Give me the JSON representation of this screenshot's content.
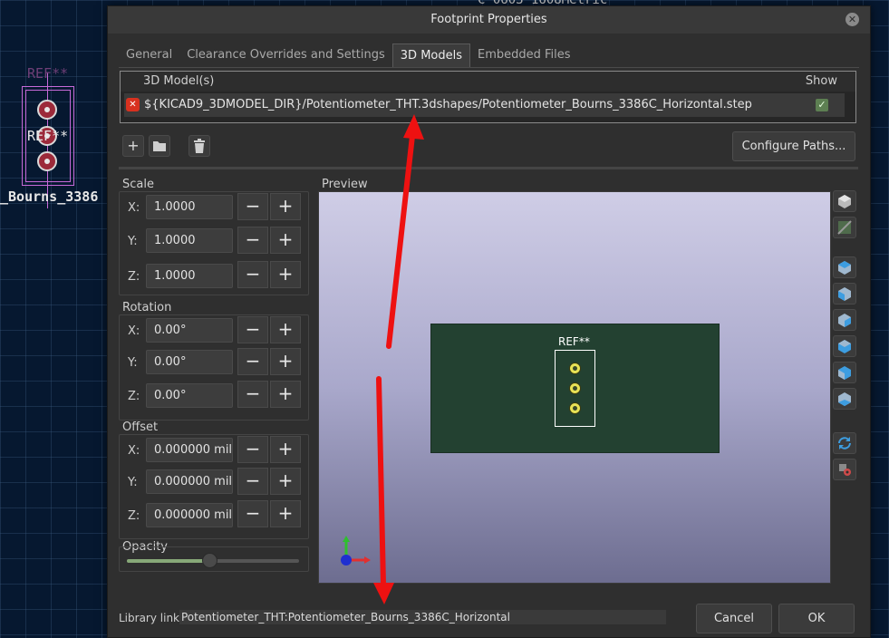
{
  "background": {
    "ref_label": "REF**",
    "ref_label_2": "REF**",
    "value_label": "_Bourns_3386",
    "top_text": "C_0603_1608Metric"
  },
  "dialog": {
    "title": "Footprint Properties",
    "close_icon": "close-icon"
  },
  "tabs": [
    {
      "label": "General",
      "active": false
    },
    {
      "label": "Clearance Overrides and Settings",
      "active": false
    },
    {
      "label": "3D Models",
      "active": true
    },
    {
      "label": "Embedded Files",
      "active": false
    }
  ],
  "models_table": {
    "header_model": "3D Model(s)",
    "header_show": "Show",
    "rows": [
      {
        "path": "${KICAD9_3DMODEL_DIR}/Potentiometer_THT.3dshapes/Potentiometer_Bourns_3386C_Horizontal.step",
        "show": true,
        "status_icon": "error-icon"
      }
    ]
  },
  "toolbar": {
    "add_icon": "plus-icon",
    "browse_icon": "folder-icon",
    "delete_icon": "trash-icon",
    "configure_label": "Configure Paths..."
  },
  "scale": {
    "label": "Scale",
    "x_label": "X:",
    "x": "1.0000",
    "y_label": "Y:",
    "y": "1.0000",
    "z_label": "Z:",
    "z": "1.0000"
  },
  "rotation": {
    "label": "Rotation",
    "x_label": "X:",
    "x": "0.00°",
    "y_label": "Y:",
    "y": "0.00°",
    "z_label": "Z:",
    "z": "0.00°"
  },
  "offset": {
    "label": "Offset",
    "x_label": "X:",
    "x": "0.000000 mil",
    "y_label": "Y:",
    "y": "0.000000 mil",
    "z_label": "Z:",
    "z": "0.000000 mil"
  },
  "opacity": {
    "label": "Opacity",
    "value": 0.48
  },
  "stepper": {
    "minus": "−",
    "plus": "+"
  },
  "preview": {
    "label": "Preview",
    "board_ref": "REF**"
  },
  "view_buttons": [
    "cube-icon",
    "board-body-icon",
    "view-front-icon",
    "view-back-icon",
    "view-left-icon",
    "view-right-icon",
    "view-top-icon",
    "view-bottom-icon",
    "reload-icon",
    "settings-icon"
  ],
  "footer": {
    "library_label": "Library link:",
    "library_value": "Potentiometer_THT:Potentiometer_Bourns_3386C_Horizontal",
    "cancel_label": "Cancel",
    "ok_label": "OK"
  },
  "colors": {
    "accent_check": "#5d7f52",
    "annotation_arrow": "#ee1111",
    "board": "#234131",
    "pad": "#e8e256"
  }
}
